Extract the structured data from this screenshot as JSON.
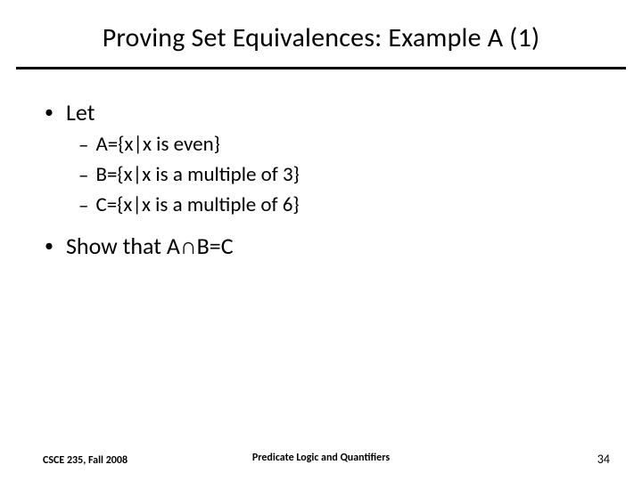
{
  "title": "Proving Set Equivalences: Example A (1)",
  "bullets": {
    "let": "Let",
    "a": "A={x|x is even}",
    "b": "B={x|x is a multiple of 3}",
    "c": "C={x|x is a multiple of 6}",
    "show_prefix": "Show that A",
    "show_op": "∩",
    "show_suffix": "B=C"
  },
  "footer": {
    "left": "CSCE 235, Fall 2008",
    "center": "Predicate Logic and Quantifiers",
    "right": "34"
  }
}
